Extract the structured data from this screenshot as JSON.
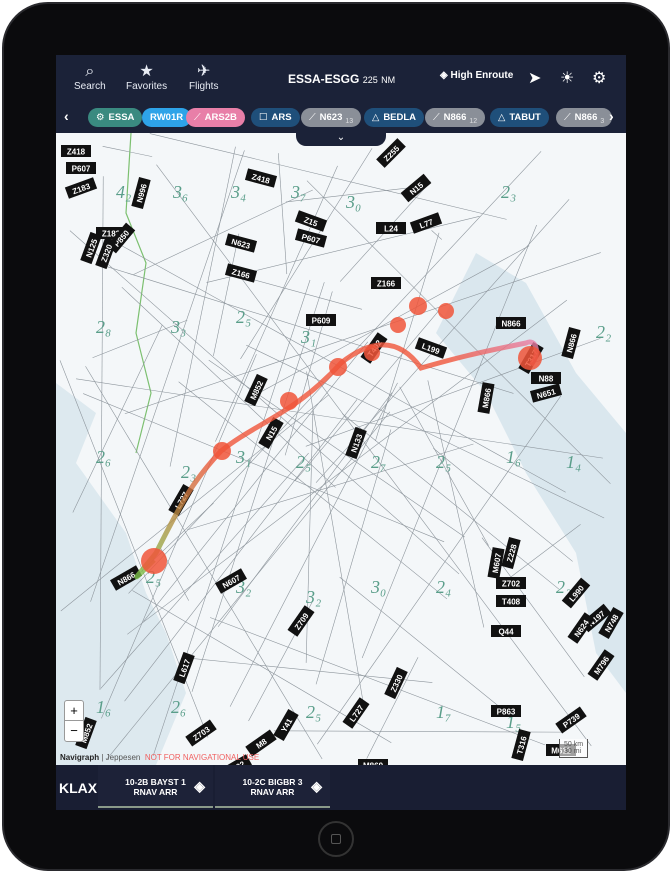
{
  "header": {
    "buttons": [
      {
        "label": "Search",
        "icon": "search-icon"
      },
      {
        "label": "Favorites",
        "icon": "star-icon"
      },
      {
        "label": "Flights",
        "icon": "airplane-icon"
      }
    ],
    "route_title": "ESSA-ESGG",
    "distance": "225",
    "distance_unit": "NM",
    "layer_label": "High Enroute"
  },
  "route_chips": [
    {
      "label": "ESSA",
      "icon": "⚙",
      "color": "#3a8a80"
    },
    {
      "label": "RW01R",
      "icon": "",
      "color": "#2ea3e8"
    },
    {
      "label": "ARS2B",
      "icon": "⟋",
      "color": "#e87fa8"
    },
    {
      "label": "ARS",
      "icon": "☐",
      "color": "#1f4f7a"
    },
    {
      "label": "N623",
      "icon": "⟋",
      "sub": "13",
      "color": "#8a8f98"
    },
    {
      "label": "BEDLA",
      "icon": "△",
      "color": "#1f4f7a"
    },
    {
      "label": "N866",
      "icon": "⟋",
      "sub": "12",
      "color": "#8a8f98"
    },
    {
      "label": "TABUT",
      "icon": "△",
      "color": "#1f4f7a"
    },
    {
      "label": "N866",
      "icon": "⟋",
      "sub": "3",
      "color": "#8a8f98"
    }
  ],
  "map": {
    "airways": [
      "Z418",
      "P607",
      "Z183",
      "N996",
      "Z418",
      "Z183",
      "N623",
      "Z166",
      "P850",
      "N125",
      "Z320",
      "Z15",
      "P607",
      "L24",
      "L77",
      "N15",
      "Z255",
      "Z166",
      "P609",
      "T402",
      "L199",
      "N88",
      "N866",
      "N651",
      "T317",
      "N866",
      "M852",
      "N15",
      "N133",
      "M866",
      "L727",
      "N866",
      "N607",
      "Z709",
      "Z330",
      "L617",
      "L727",
      "M869",
      "Z702",
      "M8",
      "Y41",
      "Z703",
      "L87",
      "M852",
      "Z228",
      "M607",
      "Z702",
      "T408",
      "Q44",
      "L990",
      "N197",
      "N624",
      "N748",
      "M796",
      "P863",
      "T316",
      "M611",
      "P739"
    ],
    "sectors": [
      "4₂",
      "3₆",
      "3₄",
      "3₇",
      "3₀",
      "2₃",
      "2₈",
      "3₃",
      "2₅",
      "3₁",
      "2₆",
      "2₃",
      "3₁",
      "2₅",
      "2₇",
      "2₅",
      "1₆",
      "1₄",
      "2₅",
      "3₂",
      "3₂",
      "3₀",
      "2₄",
      "2₂",
      "1₆",
      "2₆",
      "2₅",
      "1₇",
      "1₅",
      "2₂"
    ],
    "zoom_in": "+",
    "zoom_out": "−",
    "attribution_brand": "Navigraph",
    "attribution_source": "Jeppesen",
    "warning": "NOT FOR NAVIGATIONAL USE",
    "scale_km": "50 km",
    "scale_mi": "30 mi",
    "route_color_start": "#7cc34a",
    "route_color_end": "#f0553a"
  },
  "bottom": {
    "airport": "KLAX",
    "procedures": [
      {
        "line1": "10-2B BAYST 1",
        "line2": "RNAV ARR"
      },
      {
        "line1": "10-2C BIGBR 3",
        "line2": "RNAV ARR"
      }
    ]
  }
}
